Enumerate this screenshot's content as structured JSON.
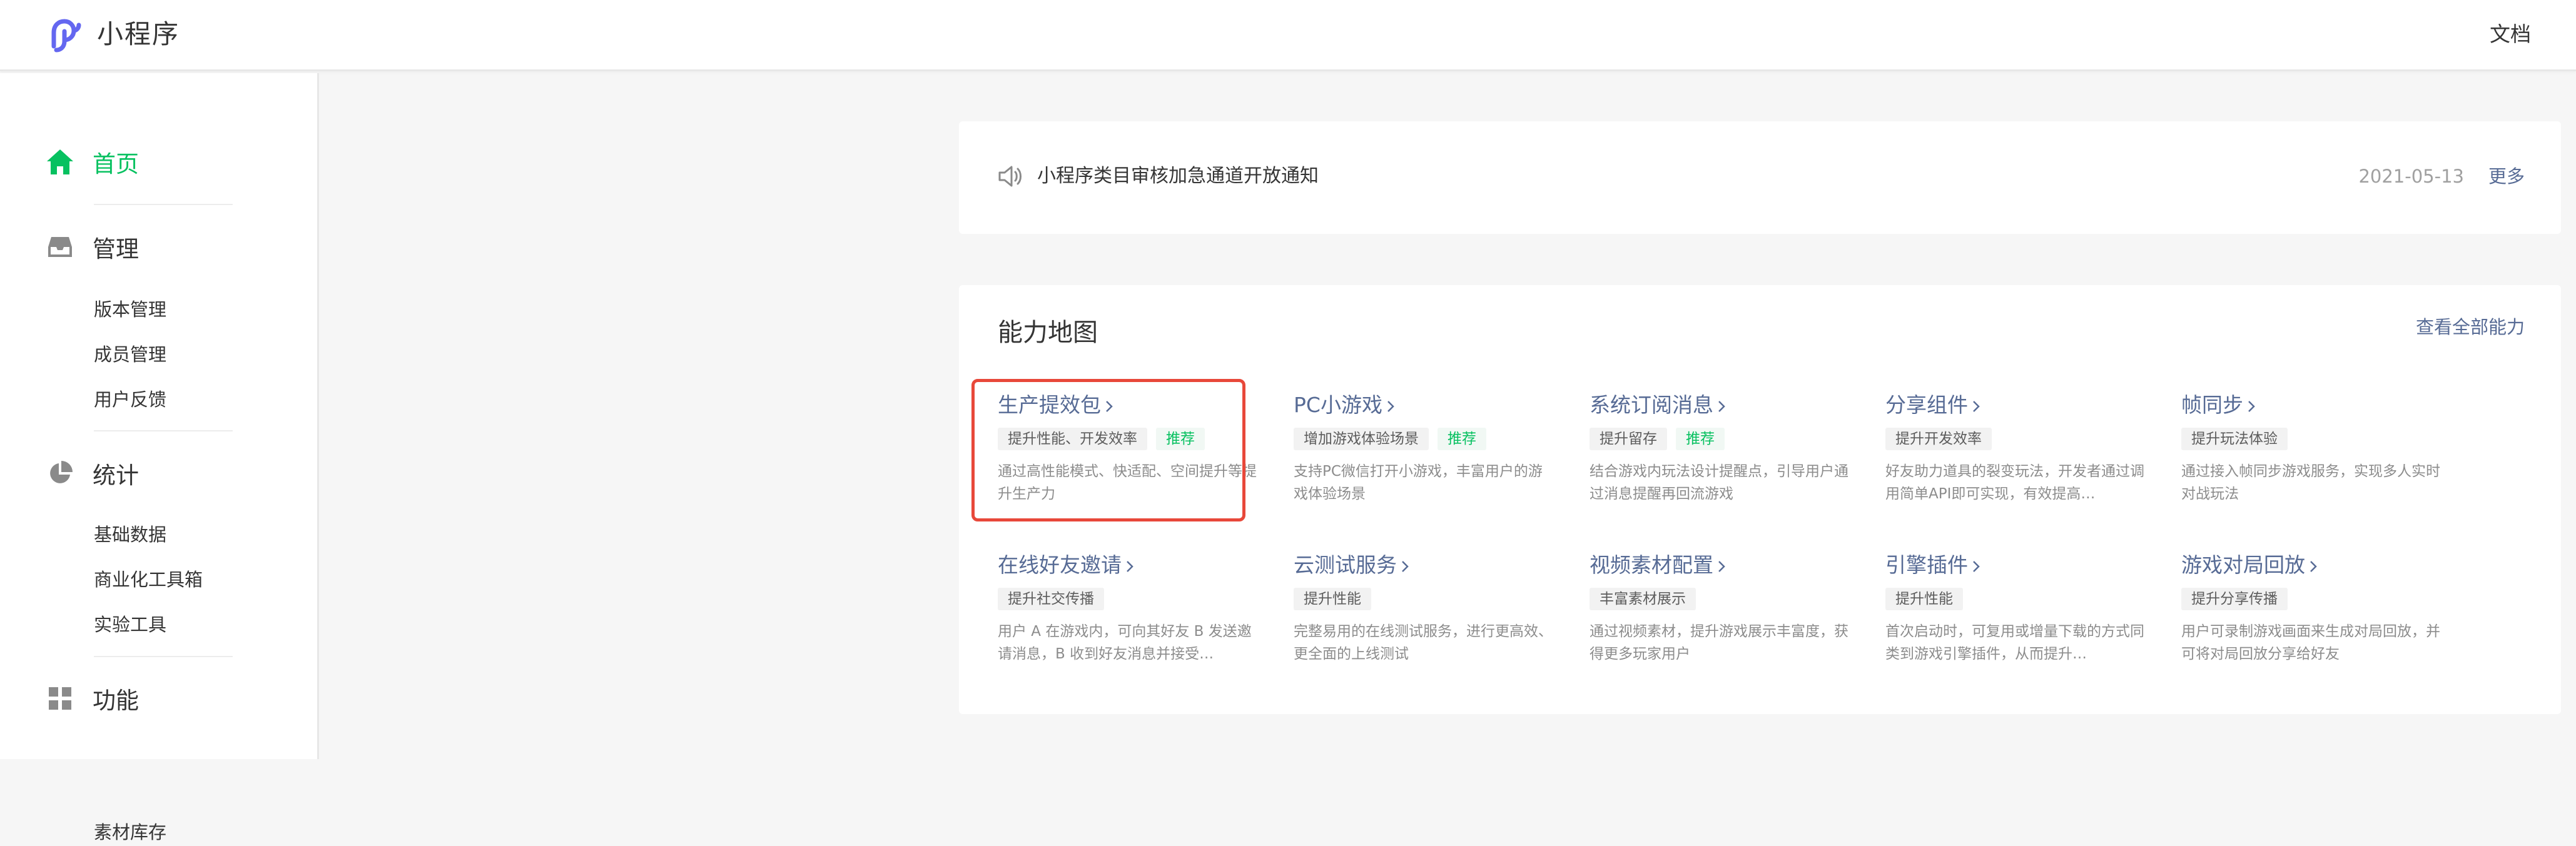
{
  "header": {
    "title": "小程序",
    "doc_link": "文档"
  },
  "sidebar": {
    "home": "首页",
    "manage": {
      "label": "管理",
      "items": [
        "版本管理",
        "成员管理",
        "用户反馈"
      ]
    },
    "stats": {
      "label": "统计",
      "items": [
        "基础数据",
        "商业化工具箱",
        "实验工具"
      ]
    },
    "features": {
      "label": "功能",
      "items": [
        "素材库存"
      ]
    }
  },
  "notice": {
    "text": "小程序类目审核加急通道开放通知",
    "date": "2021-05-13",
    "more": "更多"
  },
  "ability_map": {
    "title": "能力地图",
    "view_all": "查看全部能力",
    "items": [
      {
        "title": "生产提效包",
        "tags": [
          "提升性能、开发效率",
          "推荐"
        ],
        "desc": "通过高性能模式、快适配、空间提升等提升生产力"
      },
      {
        "title": "PC小游戏",
        "tags": [
          "增加游戏体验场景",
          "推荐"
        ],
        "desc": "支持PC微信打开小游戏，丰富用户的游戏体验场景"
      },
      {
        "title": "系统订阅消息",
        "tags": [
          "提升留存",
          "推荐"
        ],
        "desc": "结合游戏内玩法设计提醒点，引导用户通过消息提醒再回流游戏"
      },
      {
        "title": "分享组件",
        "tags": [
          "提升开发效率"
        ],
        "desc": "好友助力道具的裂变玩法，开发者通过调用简单API即可实现，有效提高…"
      },
      {
        "title": "帧同步",
        "tags": [
          "提升玩法体验"
        ],
        "desc": "通过接入帧同步游戏服务，实现多人实时对战玩法"
      },
      {
        "title": "在线好友邀请",
        "tags": [
          "提升社交传播"
        ],
        "desc": "用户 A 在游戏内，可向其好友 B 发送邀请消息，B 收到好友消息并接受…"
      },
      {
        "title": "云测试服务",
        "tags": [
          "提升性能"
        ],
        "desc": "完整易用的在线测试服务，进行更高效、更全面的上线测试"
      },
      {
        "title": "视频素材配置",
        "tags": [
          "丰富素材展示"
        ],
        "desc": "通过视频素材，提升游戏展示丰富度，获得更多玩家用户"
      },
      {
        "title": "引擎插件",
        "tags": [
          "提升性能"
        ],
        "desc": "首次启动时，可复用或增量下载的方式同类到游戏引擎插件，从而提升…"
      },
      {
        "title": "游戏对局回放",
        "tags": [
          "提升分享传播"
        ],
        "desc": "用户可录制游戏画面来生成对局回放，并可将对局回放分享给好友"
      }
    ]
  },
  "colors": {
    "accent_green": "#07c160",
    "link_blue": "#576b95",
    "highlight_red": "#e8483a"
  }
}
